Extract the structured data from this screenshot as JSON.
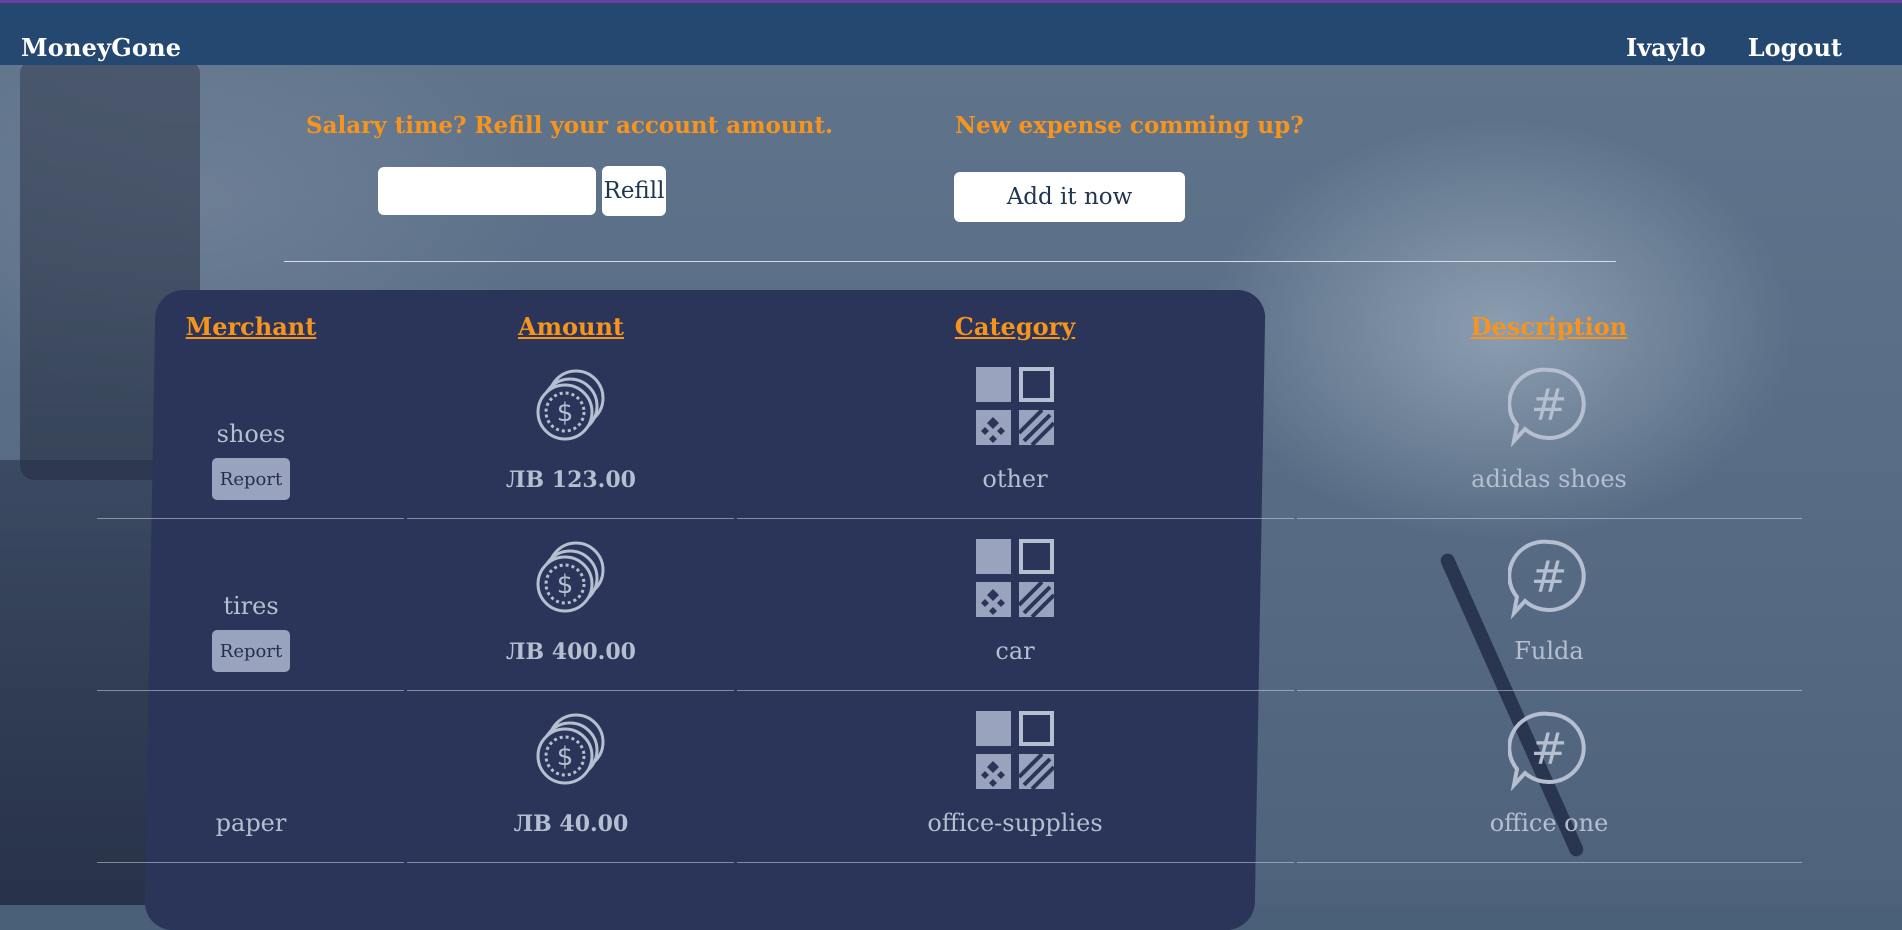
{
  "app": {
    "brand": "MoneyGone",
    "user_name": "Ivaylo",
    "logout_label": "Logout"
  },
  "refill": {
    "prompt": "Salary time? Refill your account amount.",
    "input_value": "",
    "input_placeholder": "",
    "button_label": "Refill"
  },
  "expense": {
    "prompt": "New expense comming up?",
    "button_label": "Add it now"
  },
  "table": {
    "headers": {
      "merchant": "Merchant",
      "amount": "Amount",
      "category": "Category",
      "description": "Description"
    },
    "report_label": "Report",
    "rows": [
      {
        "merchant": "shoes",
        "amount": "ЛВ 123.00",
        "category": "other",
        "description": "adidas shoes",
        "has_report": true
      },
      {
        "merchant": "tires",
        "amount": "ЛВ 400.00",
        "category": "car",
        "description": "Fulda",
        "has_report": true
      },
      {
        "merchant": "paper",
        "amount": "ЛВ 40.00",
        "category": "office-supplies",
        "description": "office one",
        "has_report": false
      }
    ]
  },
  "colors": {
    "accent": "#f7941d",
    "navbar": "#244870",
    "topline": "#6a3fa0",
    "cell_text": "#b6bfd0",
    "report_bg": "#9aa3bd"
  },
  "icons": {
    "amount": "coins-dollar-icon",
    "category": "category-grid-icon",
    "description": "hashtag-chat-icon"
  }
}
